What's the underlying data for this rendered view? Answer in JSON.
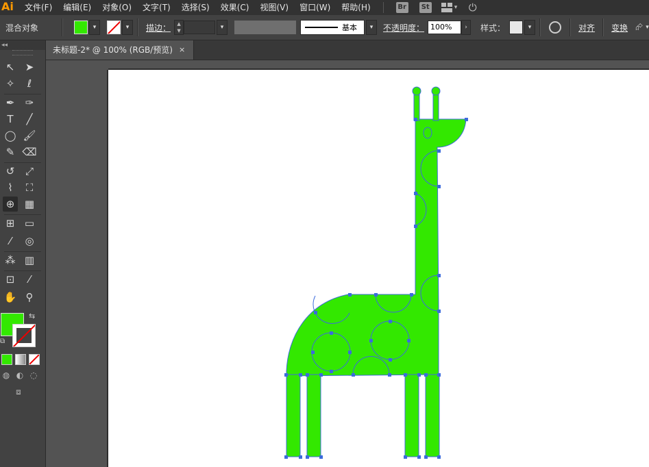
{
  "app": {
    "logo": "Ai",
    "menu": [
      "文件(F)",
      "编辑(E)",
      "对象(O)",
      "文字(T)",
      "选择(S)",
      "效果(C)",
      "视图(V)",
      "窗口(W)",
      "帮助(H)"
    ],
    "badges": [
      "Br",
      "St"
    ]
  },
  "control_bar": {
    "object_type": "混合对象",
    "fill_color": "#33e800",
    "stroke_label": "描边：",
    "stroke_profile": "基本",
    "opacity_label": "不透明度：",
    "opacity_value": "100%",
    "style_label": "样式：",
    "align_label": "对齐",
    "transform_label": "变换"
  },
  "document": {
    "tab_title": "未标题-2* @ 100% (RGB/预览)",
    "close": "×"
  },
  "toolbox": {
    "collapse": "◂◂",
    "fill_color": "#33e800",
    "stroke_color": "none"
  },
  "artwork": {
    "fill": "#33e800",
    "path_color": "#3c6bdc",
    "subject": "giraffe"
  }
}
